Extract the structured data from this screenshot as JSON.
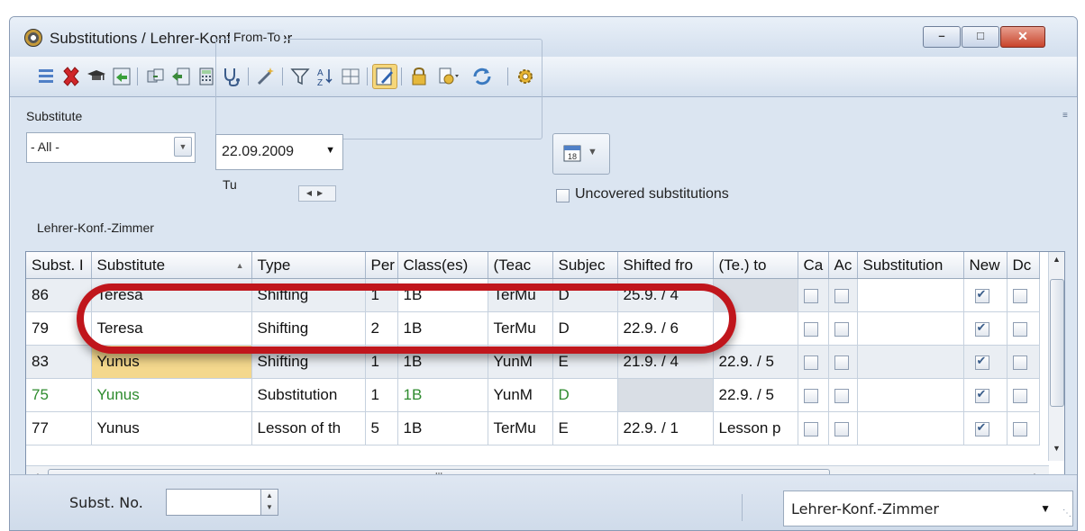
{
  "window": {
    "title": "Substitutions / Lehrer-Konf.-Zimmer",
    "controls": {
      "minimize": "–",
      "maximize": "□",
      "close": "✕"
    }
  },
  "toolbar": {
    "icons": [
      "list-icon",
      "delete-icon",
      "teacher-icon",
      "import-icon",
      "copy-icon",
      "export-icon",
      "calculator-icon",
      "stethoscope-icon",
      "wand-icon",
      "filter-icon",
      "sort-icon",
      "grid-icon",
      "edit-active-icon",
      "lock-icon",
      "document-dropdown-icon",
      "refresh-dropdown-icon",
      "gear-icon"
    ]
  },
  "filter": {
    "substitute_label": "Substitute",
    "substitute_value": "- All -",
    "fromto_label": "From-To",
    "date_value": "22.09.2009",
    "weekday": "Tu",
    "uncovered_label": "Uncovered substitutions",
    "uncovered_checked": false,
    "room_label": "Lehrer-Konf.-Zimmer"
  },
  "grid": {
    "columns": [
      "Subst. I",
      "Substitute",
      "Type",
      "Per",
      "Class(es)",
      "(Teac",
      "Subjec",
      "Shifted fro",
      "(Te.) to",
      "Ca",
      "Ac",
      "Substitution",
      "New",
      "Dc"
    ],
    "sorted_column": "Substitute",
    "rows": [
      {
        "no": "86",
        "substitute": "Teresa",
        "type": "Shifting",
        "per": "1",
        "classes": "1B",
        "teacher": "TerMu",
        "subject": "D",
        "shifted_from": "25.9. / 4",
        "to": "",
        "ca": false,
        "ac": false,
        "text": "",
        "new": true
      },
      {
        "no": "79",
        "substitute": "Teresa",
        "type": "Shifting",
        "per": "2",
        "classes": "1B",
        "teacher": "TerMu",
        "subject": "D",
        "shifted_from": "22.9. / 6",
        "to": "",
        "ca": false,
        "ac": false,
        "text": "",
        "new": true
      },
      {
        "no": "83",
        "substitute": "Yunus",
        "type": "Shifting",
        "per": "1",
        "classes": "1B",
        "teacher": "YunM",
        "subject": "E",
        "shifted_from": "21.9. / 4",
        "to": "22.9. / 5",
        "ca": false,
        "ac": false,
        "text": "",
        "new": true
      },
      {
        "no": "75",
        "substitute": "Yunus",
        "type": "Substitution",
        "per": "1",
        "classes": "1B",
        "teacher": "YunM",
        "subject": "D",
        "shifted_from": "",
        "to": "22.9. / 5",
        "ca": false,
        "ac": false,
        "text": "",
        "new": true
      },
      {
        "no": "77",
        "substitute": "Yunus",
        "type": "Lesson of th",
        "per": "5",
        "classes": "1B",
        "teacher": "TerMu",
        "subject": "E",
        "shifted_from": "22.9. / 1",
        "to": "Lesson p",
        "ca": false,
        "ac": false,
        "text": "",
        "new": true
      }
    ],
    "hscroll_thumb": "III"
  },
  "statusbar": {
    "subst_no_label": "Subst. No.",
    "subst_no_value": "",
    "room_select": "Lehrer-Konf.-Zimmer"
  },
  "colors": {
    "highlight": "#c0161c",
    "selected_cell": "#f4d88d",
    "green_text": "#2e8b2e"
  }
}
